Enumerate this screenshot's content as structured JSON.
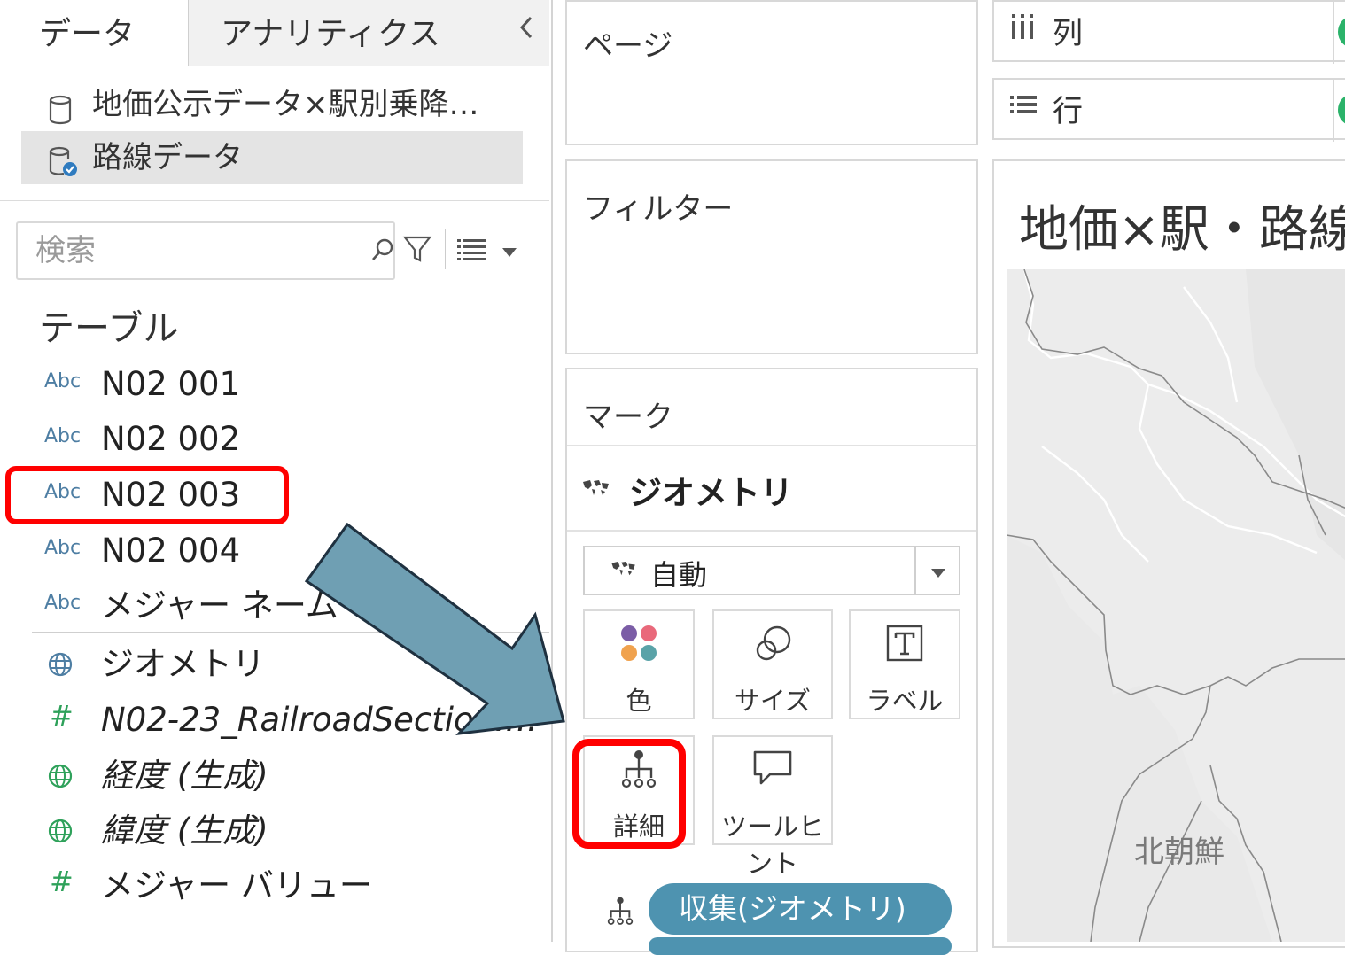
{
  "data_pane": {
    "tabs": {
      "data": "データ",
      "analytics": "アナリティクス"
    },
    "collapse_icon": "chevron-left-icon",
    "datasources": [
      {
        "label": "地価公示データ×駅別乗降…",
        "icon": "database-icon"
      },
      {
        "label": "路線データ",
        "icon": "database-check-icon",
        "selected": true
      }
    ],
    "search": {
      "placeholder": "検索"
    },
    "tables_heading": "テーブル",
    "fields": [
      {
        "type": "Abc",
        "name": "N02 001"
      },
      {
        "type": "Abc",
        "name": "N02 002"
      },
      {
        "type": "Abc",
        "name": "N02 003",
        "highlighted": true
      },
      {
        "type": "Abc",
        "name": "N02 004"
      },
      {
        "type": "Abc",
        "name": "メジャー ネーム"
      },
      {
        "type": "globe",
        "name": "ジオメトリ"
      },
      {
        "type": "#",
        "name": "N02-23_RailroadSection.…"
      },
      {
        "type": "globe",
        "name": "経度 (生成)"
      },
      {
        "type": "globe",
        "name": "緯度 (生成)"
      },
      {
        "type": "#",
        "name": "メジャー バリュー"
      }
    ]
  },
  "shelves": {
    "pages": "ページ",
    "filters": "フィルター",
    "marks": "マーク",
    "columns": "列",
    "rows": "行"
  },
  "marks": {
    "mark_type": "ジオメトリ",
    "dropdown_value": "自動",
    "buttons": {
      "color": "色",
      "size": "サイズ",
      "label": "ラベル",
      "detail": "詳細",
      "tooltip": "ツールヒント"
    },
    "pill": "収集(ジオメトリ)",
    "pill_color": "#4e93b0"
  },
  "view": {
    "title": "地価×駅・路線",
    "map_label": "北朝鮮"
  },
  "colors": {
    "highlight": "#ff0000",
    "arrow": "#6f9fb3",
    "green_pill": "#2bb36a"
  }
}
